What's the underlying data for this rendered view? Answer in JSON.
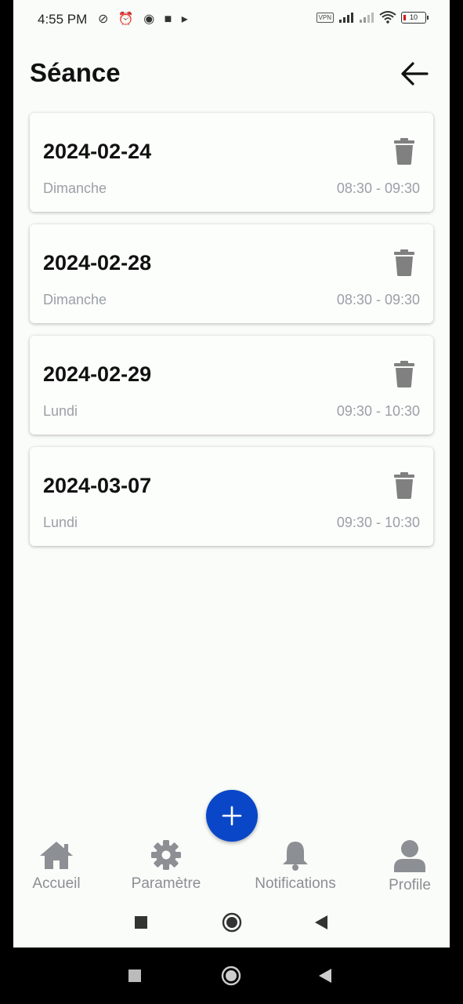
{
  "status_bar": {
    "time": "4:55 PM",
    "left_icons": "⊘ ⏰ ◉ ■ ▸",
    "vpn": "VPN",
    "battery": "10"
  },
  "header": {
    "title": "Séance"
  },
  "sessions": [
    {
      "date": "2024-02-24",
      "day": "Dimanche",
      "time": "08:30 - 09:30"
    },
    {
      "date": "2024-02-28",
      "day": "Dimanche",
      "time": "08:30 - 09:30"
    },
    {
      "date": "2024-02-29",
      "day": "Lundi",
      "time": "09:30 - 10:30"
    },
    {
      "date": "2024-03-07",
      "day": "Lundi",
      "time": "09:30 - 10:30"
    }
  ],
  "bottom_nav": {
    "items": [
      {
        "label": "Accueil",
        "icon": "home-icon"
      },
      {
        "label": "Paramètre",
        "icon": "gear-icon"
      },
      {
        "label": "Notifications",
        "icon": "bell-icon"
      },
      {
        "label": "Profile",
        "icon": "user-icon"
      }
    ]
  },
  "colors": {
    "accent": "#0a47c8",
    "background": "#f9fcf9",
    "muted_text": "#9aa0a6",
    "icon_gray": "#808080"
  }
}
